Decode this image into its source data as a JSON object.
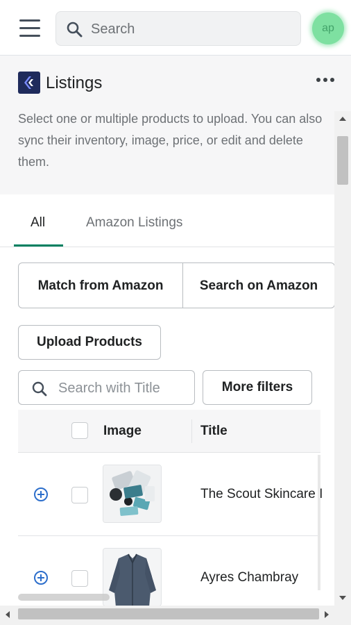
{
  "topbar": {
    "search_placeholder": "Search",
    "avatar_initials": "ap",
    "avatar_color": "#7ee0a1"
  },
  "header": {
    "title": "Listings",
    "more_icon": "ellipsis-icon"
  },
  "description": "Select one or multiple products to upload. You can also sync their inventory, image, price, or edit and delete them.",
  "tabs": [
    {
      "label": "All",
      "selected": true
    },
    {
      "label": "Amazon Listings",
      "selected": false
    }
  ],
  "actions": {
    "match_label": "Match from Amazon",
    "search_label": "Search on Amazon",
    "upload_label": "Upload Products",
    "filters_label": "More filters",
    "title_search_placeholder": "Search with Title"
  },
  "table": {
    "columns": [
      "Image",
      "Title"
    ],
    "rows": [
      {
        "title": "The Scout Skincare I"
      },
      {
        "title": "Ayres Chambray"
      }
    ]
  },
  "colors": {
    "accent": "#008060",
    "link": "#2c6ecb"
  }
}
